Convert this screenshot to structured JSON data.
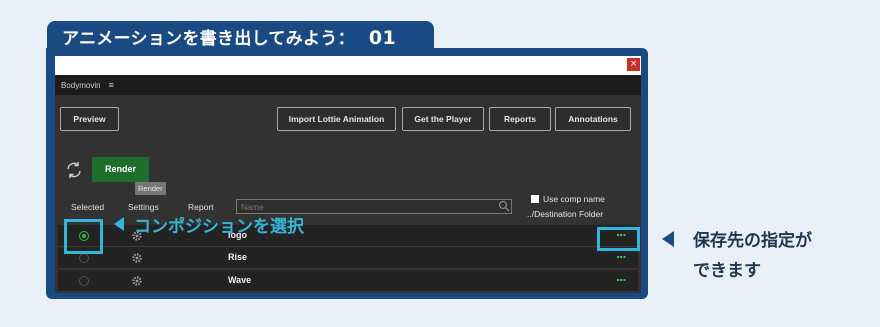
{
  "heading": {
    "title": "アニメーションを書き出してみよう：",
    "number": "01"
  },
  "window": {
    "close": "×",
    "panel_title": "Bodymovin",
    "menu_icon": "≡"
  },
  "toolbar": {
    "preview": "Preview",
    "import": "Import Lottie Animation",
    "get_player": "Get the Player",
    "reports": "Reports",
    "annotations": "Annotations"
  },
  "render": {
    "label": "Render",
    "tooltip": "Render"
  },
  "columns": {
    "selected": "Selected",
    "settings": "Settings",
    "report": "Report"
  },
  "search": {
    "placeholder": "Name"
  },
  "options": {
    "use_comp_name": "Use comp name",
    "destination": "../Destination Folder"
  },
  "rows": [
    {
      "name": "logo",
      "selected": true,
      "more": "..."
    },
    {
      "name": "Rise",
      "selected": false,
      "more": "..."
    },
    {
      "name": "Wave",
      "selected": false,
      "more": "..."
    }
  ],
  "annotations": {
    "select_comp": "コンポジションを選択",
    "save_dest_line1": "保存先の指定が",
    "save_dest_line2": "できます"
  },
  "colors": {
    "accent": "#33b7d8",
    "navy": "#1a4a83",
    "render_green": "#1e6e2c",
    "dots_green": "#2fd160"
  }
}
